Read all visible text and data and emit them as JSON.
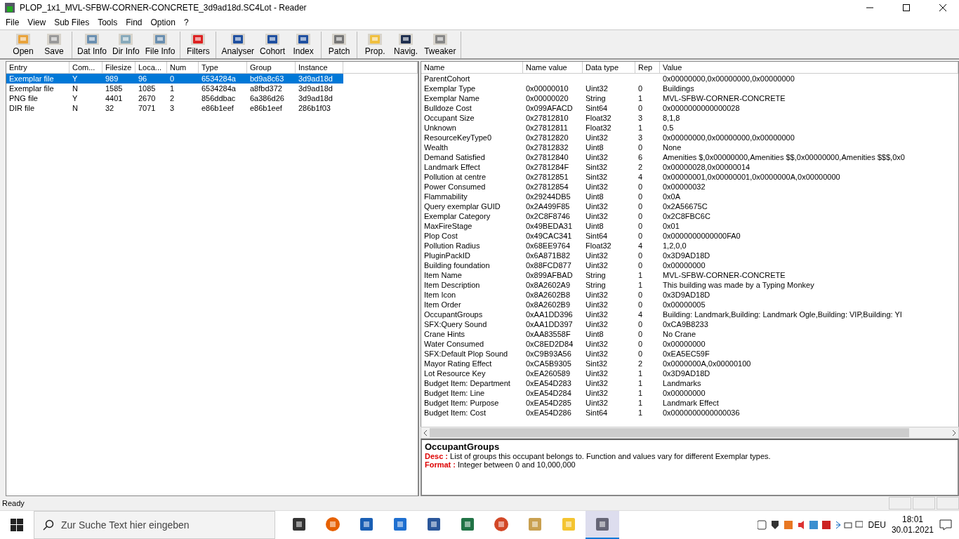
{
  "window": {
    "title": "PLOP_1x1_MVL-SFBW-CORNER-CONCRETE_3d9ad18d.SC4Lot - Reader"
  },
  "menu": [
    "File",
    "View",
    "Sub Files",
    "Tools",
    "Find",
    "Option",
    "?"
  ],
  "toolbar": [
    [
      "Open",
      "Save"
    ],
    [
      "Dat Info",
      "Dir Info",
      "File Info"
    ],
    [
      "Filters"
    ],
    [
      "Analyser",
      "Cohort",
      "Index"
    ],
    [
      "Patch"
    ],
    [
      "Prop.",
      "Navig.",
      "Tweaker"
    ]
  ],
  "entries": {
    "columns": [
      "Entry",
      "Com...",
      "Filesize",
      "Loca...",
      "Num",
      "Type",
      "Group",
      "Instance"
    ],
    "rows": [
      {
        "cells": [
          "Exemplar file",
          "Y",
          "989",
          "96",
          "0",
          "6534284a",
          "bd9a8c63",
          "3d9ad18d"
        ],
        "selected": true
      },
      {
        "cells": [
          "Exemplar file",
          "N",
          "1585",
          "1085",
          "1",
          "6534284a",
          "a8fbd372",
          "3d9ad18d"
        ],
        "selected": false
      },
      {
        "cells": [
          "PNG file",
          "Y",
          "4401",
          "2670",
          "2",
          "856ddbac",
          "6a386d26",
          "3d9ad18d"
        ],
        "selected": false
      },
      {
        "cells": [
          "DIR file",
          "N",
          "32",
          "7071",
          "3",
          "e86b1eef",
          "e86b1eef",
          "286b1f03"
        ],
        "selected": false
      }
    ]
  },
  "properties": {
    "columns": [
      "Name",
      "Name value",
      "Data type",
      "Rep",
      "Value"
    ],
    "rows": [
      [
        "ParentCohort",
        "",
        "",
        "",
        "0x00000000,0x00000000,0x00000000"
      ],
      [
        "Exemplar Type",
        "0x00000010",
        "Uint32",
        "0",
        "Buildings"
      ],
      [
        "Exemplar Name",
        "0x00000020",
        "String",
        "1",
        "MVL-SFBW-CORNER-CONCRETE"
      ],
      [
        "Bulldoze Cost",
        "0x099AFACD",
        "Sint64",
        "0",
        "0x0000000000000028"
      ],
      [
        "Occupant Size",
        "0x27812810",
        "Float32",
        "3",
        "8,1,8"
      ],
      [
        "Unknown",
        "0x27812811",
        "Float32",
        "1",
        "0.5"
      ],
      [
        "ResourceKeyType0",
        "0x27812820",
        "Uint32",
        "3",
        "0x00000000,0x00000000,0x00000000"
      ],
      [
        "Wealth",
        "0x27812832",
        "Uint8",
        "0",
        "None"
      ],
      [
        "Demand Satisfied",
        "0x27812840",
        "Uint32",
        "6",
        "Amenities $,0x00000000,Amenities $$,0x00000000,Amenities $$$,0x0"
      ],
      [
        "Landmark Effect",
        "0x2781284F",
        "Sint32",
        "2",
        "0x00000028,0x00000014"
      ],
      [
        "Pollution at centre",
        "0x27812851",
        "Sint32",
        "4",
        "0x00000001,0x00000001,0x0000000A,0x00000000"
      ],
      [
        "Power Consumed",
        "0x27812854",
        "Uint32",
        "0",
        "0x00000032"
      ],
      [
        "Flammability",
        "0x29244DB5",
        "Uint8",
        "0",
        "0x0A"
      ],
      [
        "Query exemplar GUID",
        "0x2A499F85",
        "Uint32",
        "0",
        "0x2A56675C"
      ],
      [
        "Exemplar Category",
        "0x2C8F8746",
        "Uint32",
        "0",
        "0x2C8FBC6C"
      ],
      [
        "MaxFireStage",
        "0x49BEDA31",
        "Uint8",
        "0",
        "0x01"
      ],
      [
        "Plop Cost",
        "0x49CAC341",
        "Sint64",
        "0",
        "0x0000000000000FA0"
      ],
      [
        "Pollution Radius",
        "0x68EE9764",
        "Float32",
        "4",
        "1,2,0,0"
      ],
      [
        "PluginPackID",
        "0x6A871B82",
        "Uint32",
        "0",
        "0x3D9AD18D"
      ],
      [
        "Building foundation",
        "0x88FCD877",
        "Uint32",
        "0",
        "0x00000000"
      ],
      [
        "Item Name",
        "0x899AFBAD",
        "String",
        "1",
        "MVL-SFBW-CORNER-CONCRETE"
      ],
      [
        "Item Description",
        "0x8A2602A9",
        "String",
        "1",
        "This building was made by a Typing Monkey"
      ],
      [
        "Item Icon",
        "0x8A2602B8",
        "Uint32",
        "0",
        "0x3D9AD18D"
      ],
      [
        "Item Order",
        "0x8A2602B9",
        "Uint32",
        "0",
        "0x00000005"
      ],
      [
        "OccupantGroups",
        "0xAA1DD396",
        "Uint32",
        "4",
        "Building: Landmark,Building: Landmark Ogle,Building: VIP,Building: YI"
      ],
      [
        "SFX:Query Sound",
        "0xAA1DD397",
        "Uint32",
        "0",
        "0xCA9B8233"
      ],
      [
        "Crane Hints",
        "0xAA83558F",
        "Uint8",
        "0",
        "No Crane"
      ],
      [
        "Water Consumed",
        "0xC8ED2D84",
        "Uint32",
        "0",
        "0x00000000"
      ],
      [
        "SFX:Default Plop Sound",
        "0xC9B93A56",
        "Uint32",
        "0",
        "0xEA5EC59F"
      ],
      [
        "Mayor Rating Effect",
        "0xCA5B9305",
        "Sint32",
        "2",
        "0x0000000A,0x00000100"
      ],
      [
        "Lot Resource Key",
        "0xEA260589",
        "Uint32",
        "1",
        "0x3D9AD18D"
      ],
      [
        "Budget Item: Department",
        "0xEA54D283",
        "Uint32",
        "1",
        "Landmarks"
      ],
      [
        "Budget Item: Line",
        "0xEA54D284",
        "Uint32",
        "1",
        "0x00000000"
      ],
      [
        "Budget Item: Purpose",
        "0xEA54D285",
        "Uint32",
        "1",
        "Landmark Effect"
      ],
      [
        "Budget Item: Cost",
        "0xEA54D286",
        "Sint64",
        "1",
        "0x0000000000000036"
      ]
    ]
  },
  "description": {
    "title": "OccupantGroups",
    "lines": [
      {
        "label": "Desc :",
        "text": "List of groups this occupant belongs to. Function and values vary for different Exemplar types."
      },
      {
        "label": "Format :",
        "text": "Integer between 0 and 10,000,000"
      }
    ]
  },
  "status_bar": "Ready",
  "taskbar": {
    "search_placeholder": "Zur Suche Text hier eingeben",
    "apps": [
      {
        "selected": false
      },
      {
        "selected": false
      },
      {
        "selected": false
      },
      {
        "selected": false
      },
      {
        "selected": false
      },
      {
        "selected": false
      },
      {
        "selected": false
      },
      {
        "selected": false
      },
      {
        "selected": false
      },
      {
        "selected": true
      }
    ],
    "language": "DEU",
    "time": "18:01",
    "date": "30.01.2021"
  }
}
